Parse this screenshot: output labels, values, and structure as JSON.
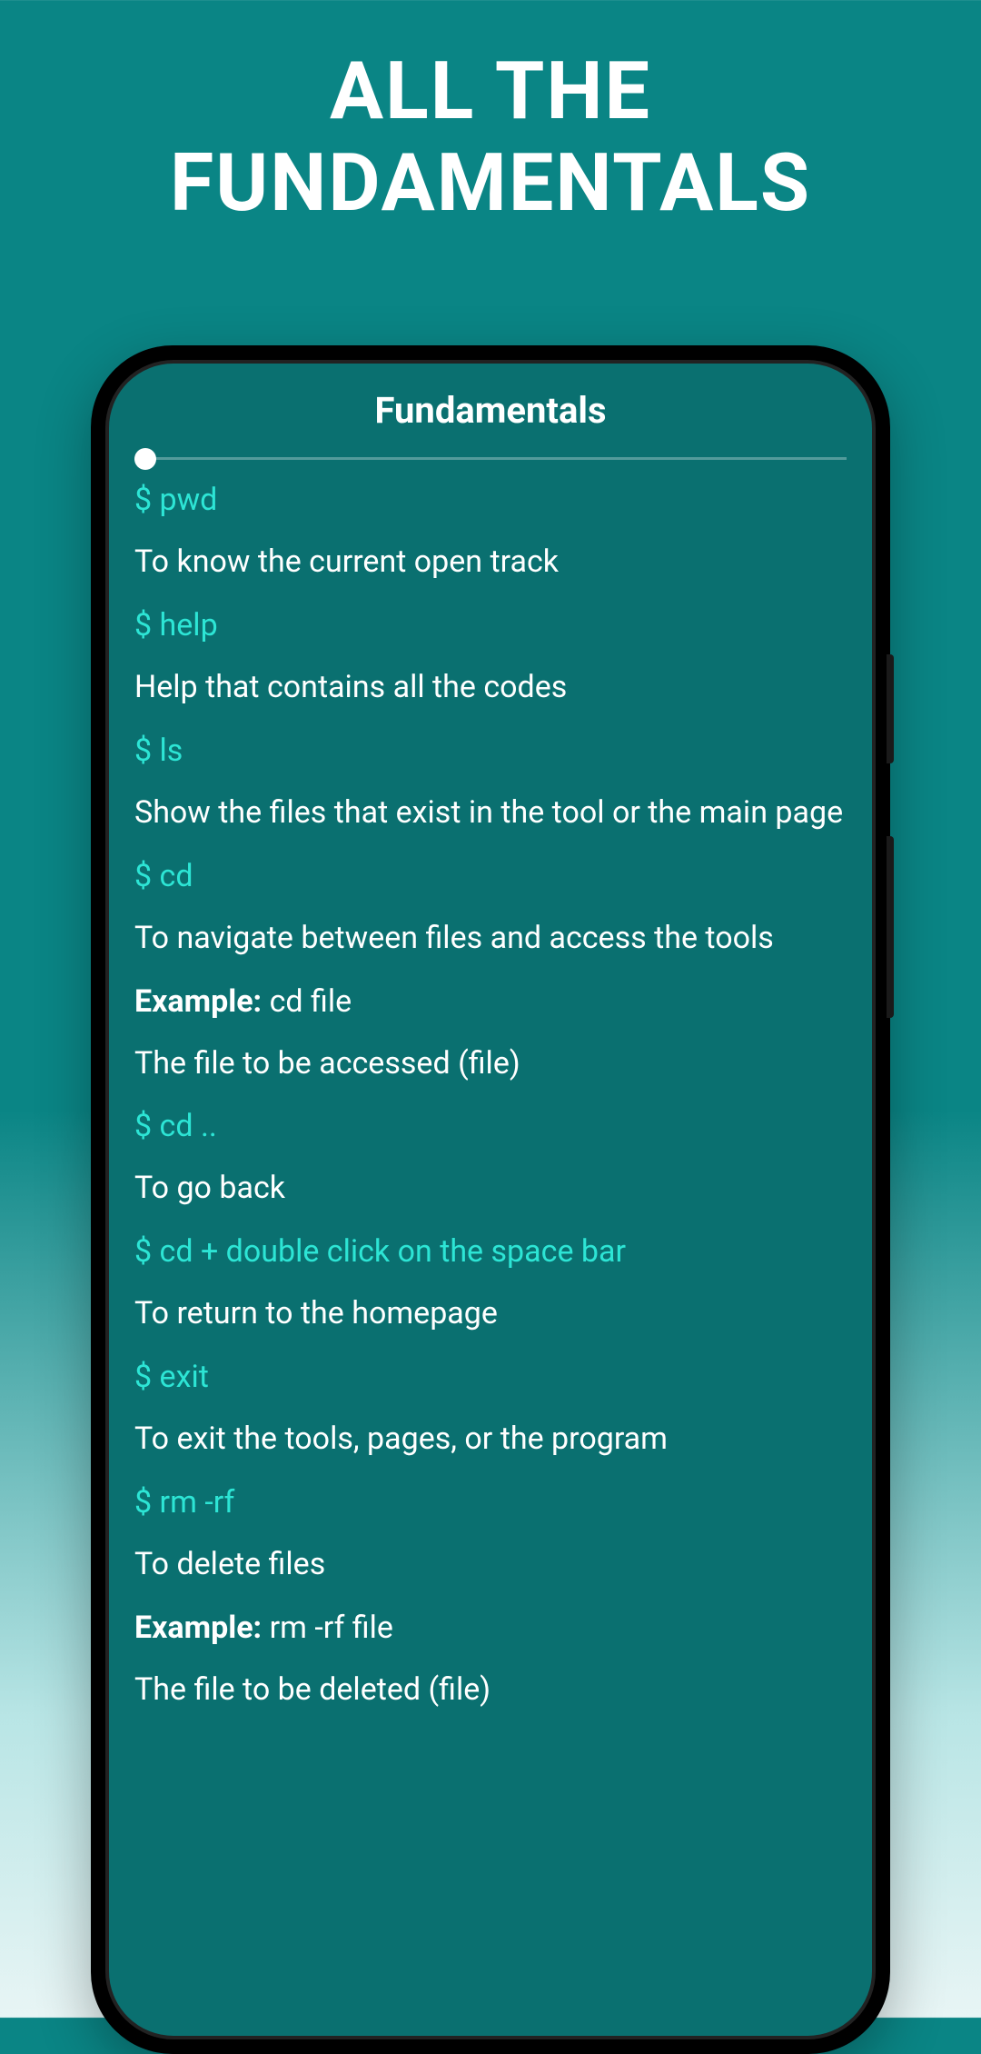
{
  "hero": {
    "line1": "ALL THE",
    "line2": "FUNDAMENTALS"
  },
  "screen": {
    "title": "Fundamentals",
    "items": [
      {
        "type": "command",
        "text": "$ pwd"
      },
      {
        "type": "description",
        "text": "To know the current open track"
      },
      {
        "type": "command",
        "text": "$ help"
      },
      {
        "type": "description",
        "text": "Help that contains all the codes"
      },
      {
        "type": "command",
        "text": "$ ls"
      },
      {
        "type": "description",
        "text": "Show the files that exist in the tool or the main page"
      },
      {
        "type": "command",
        "text": "$ cd"
      },
      {
        "type": "description",
        "text": "To navigate between files and access the tools"
      },
      {
        "type": "example",
        "label": "Example:",
        "text": " cd file"
      },
      {
        "type": "description",
        "text": "The file to be accessed (file)"
      },
      {
        "type": "command",
        "text": "$ cd .."
      },
      {
        "type": "description",
        "text": "To go back"
      },
      {
        "type": "command",
        "text": "$ cd + double click on the space bar"
      },
      {
        "type": "description",
        "text": "To return to the homepage"
      },
      {
        "type": "command",
        "text": "$ exit"
      },
      {
        "type": "description",
        "text": "To exit the tools, pages, or the program"
      },
      {
        "type": "command",
        "text": "$ rm -rf"
      },
      {
        "type": "description",
        "text": "To delete files"
      },
      {
        "type": "example",
        "label": "Example:",
        "text": " rm -rf file"
      },
      {
        "type": "description",
        "text": "The file to be deleted (file)"
      }
    ]
  }
}
